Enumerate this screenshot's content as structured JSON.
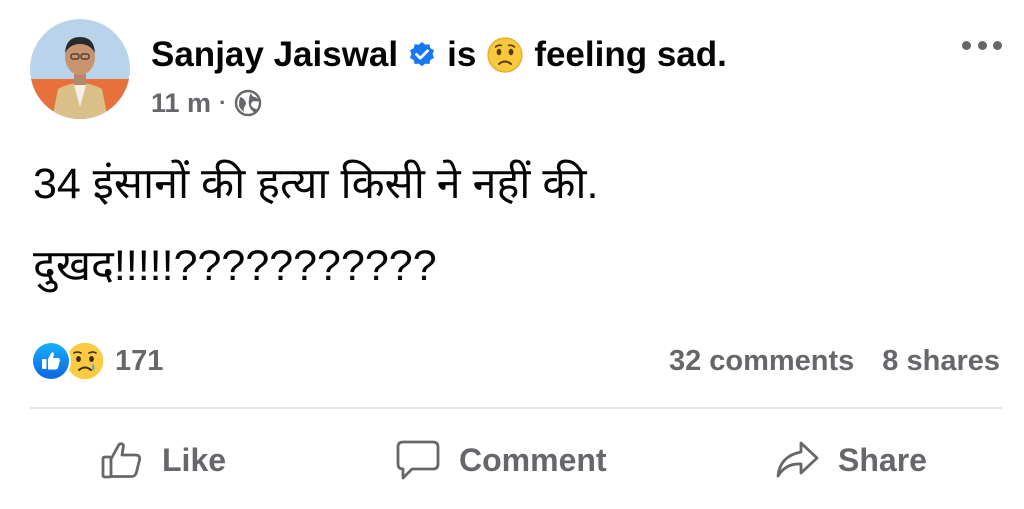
{
  "post": {
    "author": "Sanjay Jaiswal",
    "status_is": "is",
    "feeling": "feeling sad.",
    "time": "11 m",
    "meta_separator": "·",
    "body_lines": [
      "34 इंसानों की हत्या किसी ने नहीं की.",
      "दुखद!!!!!???????????"
    ]
  },
  "engagement": {
    "reaction_count": "171",
    "comments": "32 comments",
    "shares": "8 shares"
  },
  "actions": {
    "like_label": "Like",
    "comment_label": "Comment",
    "share_label": "Share"
  },
  "icons": {
    "verified": "verified-badge-icon",
    "feeling": "sad-face-icon",
    "audience": "globe-icon",
    "more": "more-options-icon",
    "like_reaction": "like-reaction-icon",
    "sad_reaction": "sad-reaction-icon"
  },
  "colors": {
    "brand_blue": "#1877f2",
    "secondary_text": "#65676b",
    "primary_text": "#050505",
    "divider": "#e4e6eb"
  }
}
